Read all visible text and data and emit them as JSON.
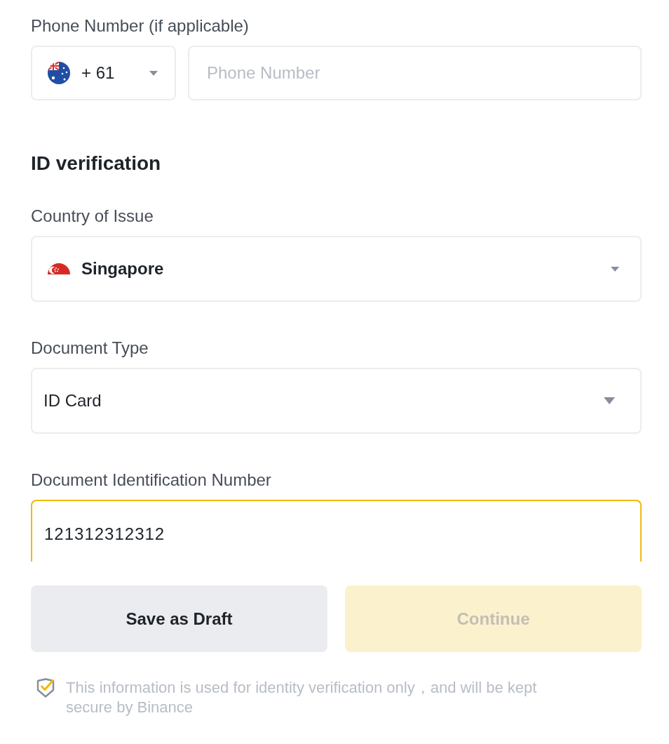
{
  "phone": {
    "label": "Phone Number (if applicable)",
    "code": "+ 61",
    "placeholder": "Phone Number"
  },
  "id_verification": {
    "title": "ID verification",
    "fields": [
      {
        "kind": "country",
        "label": "Country of Issue",
        "value": "Singapore",
        "focused": false
      },
      {
        "kind": "select",
        "label": "Document Type",
        "value": "ID Card",
        "focused": false
      },
      {
        "kind": "input",
        "label": "Document Identification Number",
        "value": "121312312312",
        "focused": true
      }
    ]
  },
  "buttons": [
    {
      "label": "Save as Draft",
      "kind": "secondary",
      "disabled": false
    },
    {
      "label": "Continue",
      "kind": "primary",
      "disabled": true
    }
  ],
  "notice": {
    "text": "This information is used for identity verification only，and will be kept secure by Binance"
  }
}
